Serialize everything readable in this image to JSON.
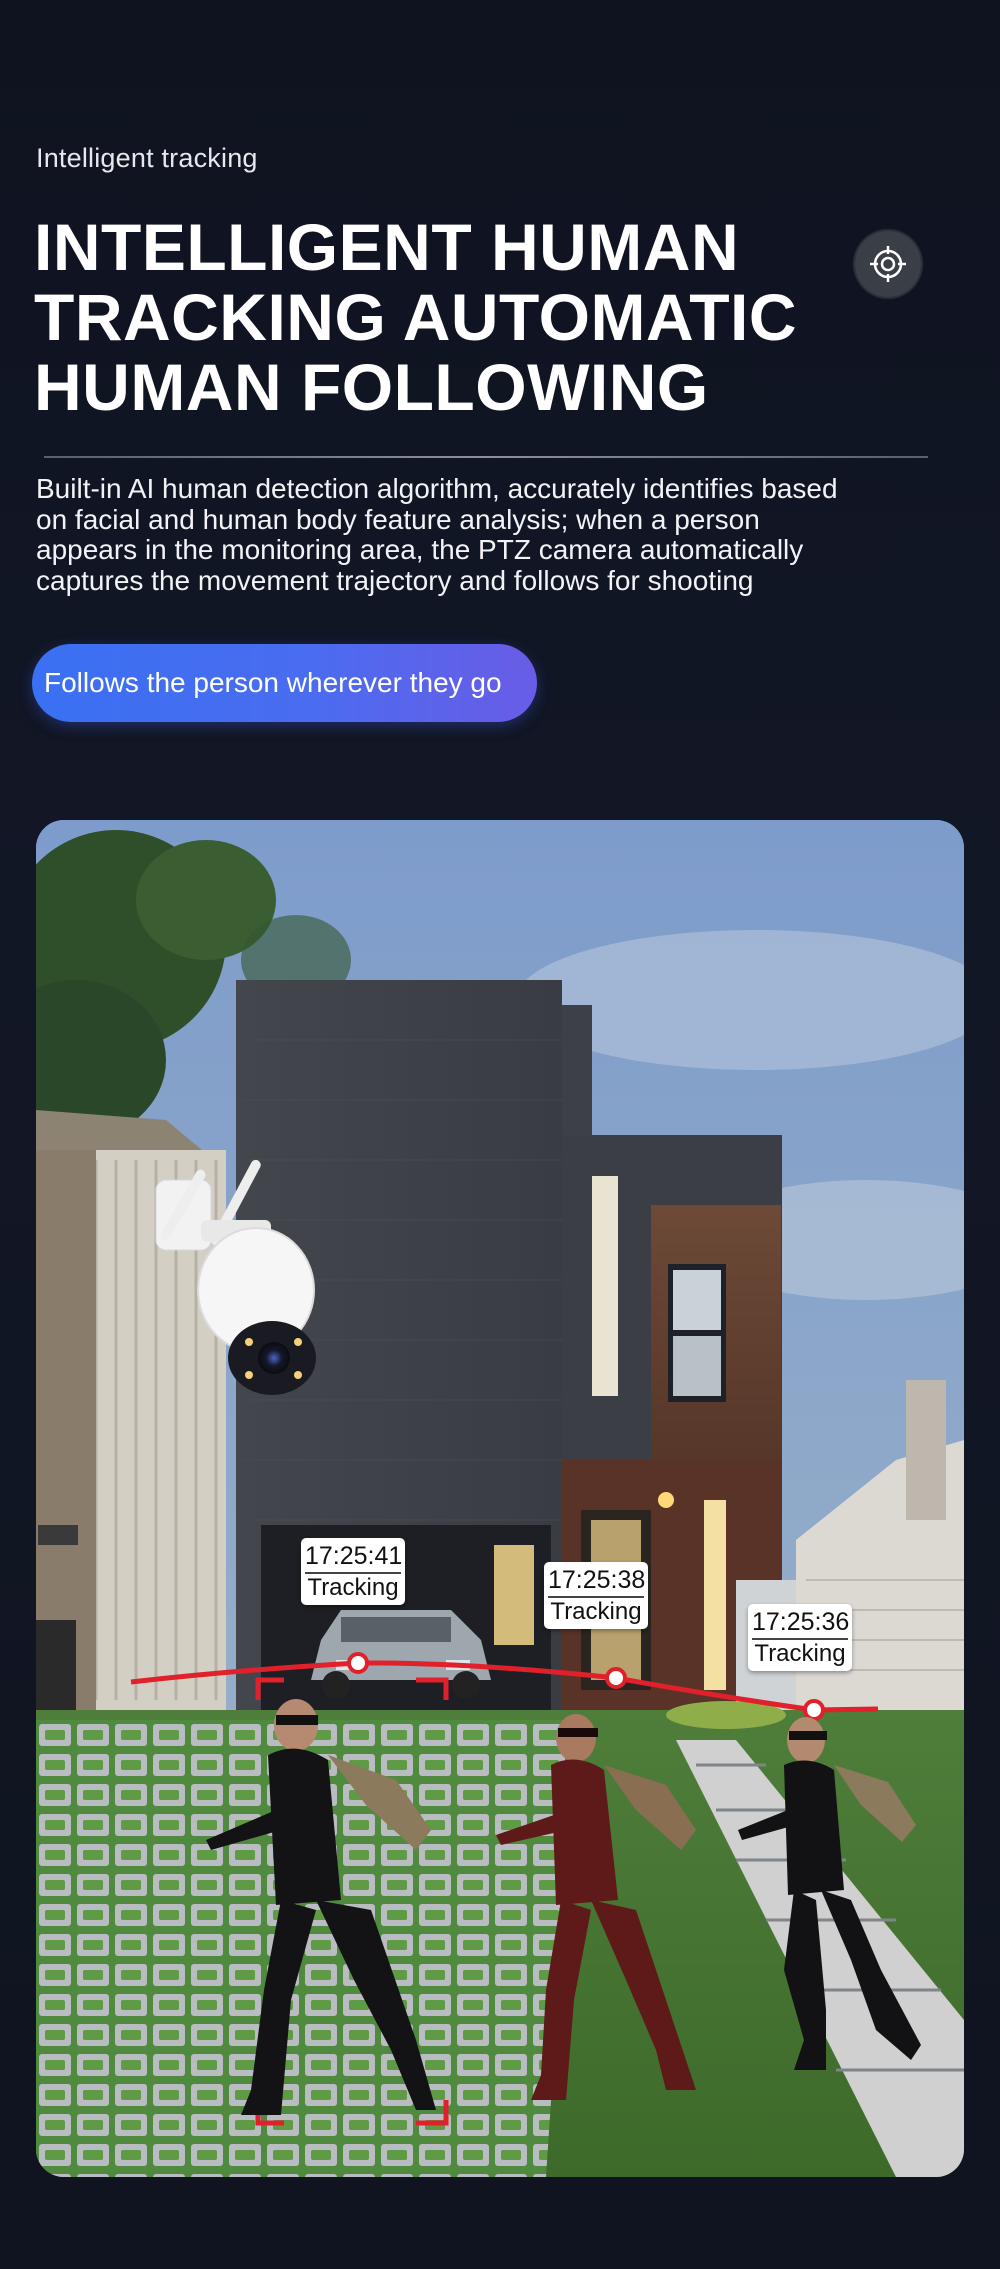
{
  "section": {
    "eyebrow": "Intelligent tracking",
    "headline": "INTELLIGENT HUMAN\nTRACKING AUTOMATIC\nHUMAN FOLLOWING",
    "description": "Built-in AI human detection algorithm, accurately identifies based on facial and human body feature analysis; when a person appears in the monitoring area, the PTZ camera automatically captures the movement trajectory and follows for shooting",
    "cta_label": "Follows the person wherever they go",
    "target_icon": "crosshair-target-icon"
  },
  "illustration": {
    "trajectory_color": "#e0202a",
    "points": [
      {
        "time": "17:25:41",
        "status": "Tracking"
      },
      {
        "time": "17:25:38",
        "status": "Tracking"
      },
      {
        "time": "17:25:36",
        "status": "Tracking"
      }
    ]
  },
  "colors": {
    "background": "#111521",
    "cta_gradient_start": "#3a70f2",
    "cta_gradient_end": "#6a5ce6"
  }
}
